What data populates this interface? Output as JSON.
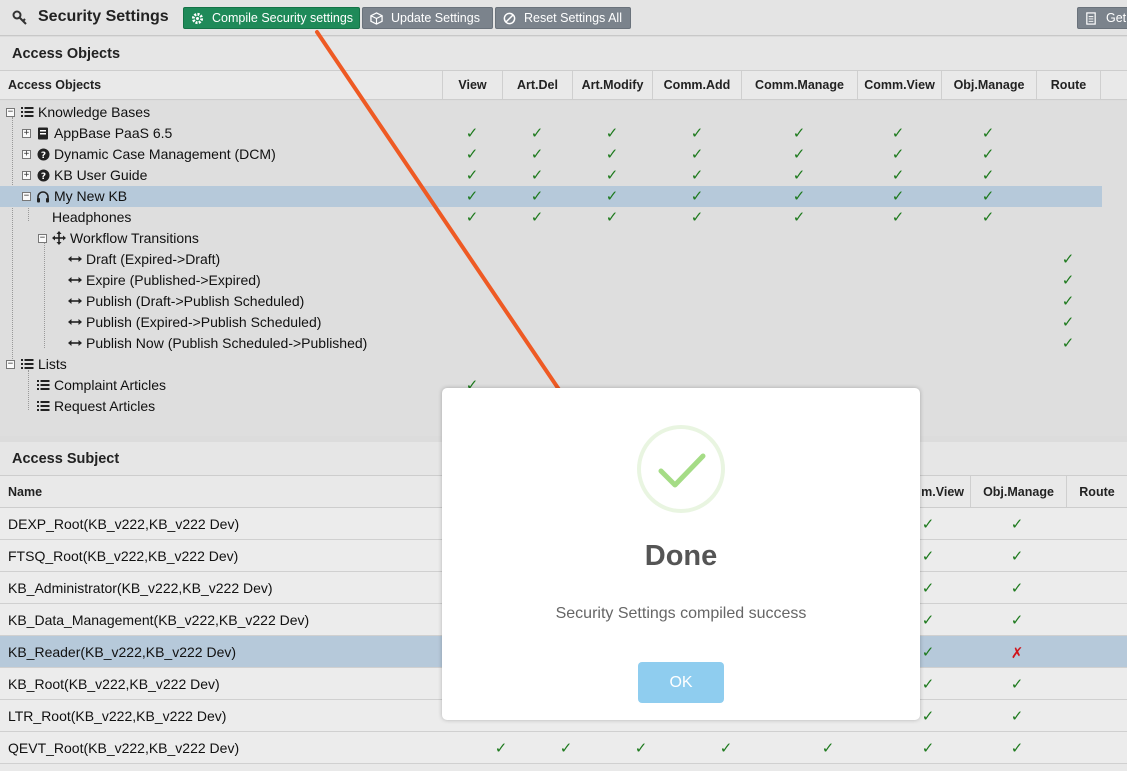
{
  "toolbar": {
    "title": "Security Settings",
    "title_icon": "key-icon",
    "compile_label": "Compile Security settings",
    "update_label": "Update Settings",
    "reset_label": "Reset Settings All",
    "get_label": "Get"
  },
  "objects_section": {
    "title": "Access Objects",
    "columns": [
      "Access Objects",
      "View",
      "Art.Del",
      "Art.Modify",
      "Comm.Add",
      "Comm.Manage",
      "Comm.View",
      "Obj.Manage",
      "Route"
    ],
    "rows": [
      {
        "label": "Knowledge Bases",
        "icon": "list-icon",
        "expander": "minus",
        "checks": []
      },
      {
        "label": "AppBase PaaS 6.5",
        "icon": "book-icon",
        "expander": "plus",
        "checks": [
          "View",
          "Art.Del",
          "Art.Modify",
          "Comm.Add",
          "Comm.Manage",
          "Comm.View",
          "Obj.Manage"
        ]
      },
      {
        "label": "Dynamic Case Management (DCM)",
        "icon": "question-icon",
        "expander": "plus",
        "checks": [
          "View",
          "Art.Del",
          "Art.Modify",
          "Comm.Add",
          "Comm.Manage",
          "Comm.View",
          "Obj.Manage"
        ]
      },
      {
        "label": "KB User Guide",
        "icon": "question-icon",
        "expander": "plus",
        "checks": [
          "View",
          "Art.Del",
          "Art.Modify",
          "Comm.Add",
          "Comm.Manage",
          "Comm.View",
          "Obj.Manage"
        ]
      },
      {
        "label": "My New KB",
        "icon": "headphones-icon",
        "expander": "minus",
        "selected": true,
        "checks": [
          "View",
          "Art.Del",
          "Art.Modify",
          "Comm.Add",
          "Comm.Manage",
          "Comm.View",
          "Obj.Manage"
        ]
      },
      {
        "label": "Headphones",
        "icon": "",
        "expander": "",
        "checks": [
          "View",
          "Art.Del",
          "Art.Modify",
          "Comm.Add",
          "Comm.Manage",
          "Comm.View",
          "Obj.Manage"
        ]
      },
      {
        "label": "Workflow Transitions",
        "icon": "arrows-move-icon",
        "expander": "minus",
        "checks": []
      },
      {
        "label": "Draft (Expired->Draft)",
        "icon": "arrow-horizontal-icon",
        "expander": "",
        "checks": [
          "Route"
        ]
      },
      {
        "label": "Expire (Published->Expired)",
        "icon": "arrow-horizontal-icon",
        "expander": "",
        "checks": [
          "Route"
        ]
      },
      {
        "label": "Publish (Draft->Publish Scheduled)",
        "icon": "arrow-horizontal-icon",
        "expander": "",
        "checks": [
          "Route"
        ]
      },
      {
        "label": "Publish (Expired->Publish Scheduled)",
        "icon": "arrow-horizontal-icon",
        "expander": "",
        "checks": [
          "Route"
        ]
      },
      {
        "label": "Publish Now (Publish Scheduled->Published)",
        "icon": "arrow-horizontal-icon",
        "expander": "",
        "checks": [
          "Route"
        ]
      },
      {
        "label": "Lists",
        "icon": "list-icon",
        "expander": "minus",
        "checks": []
      },
      {
        "label": "Complaint Articles",
        "icon": "list-icon",
        "expander": "",
        "checks": [
          "View"
        ]
      },
      {
        "label": "Request Articles",
        "icon": "list-icon",
        "expander": "",
        "checks": []
      }
    ]
  },
  "subject_section": {
    "title": "Access Subject",
    "columns": [
      "Name",
      "m.View",
      "Obj.Manage",
      "Route"
    ],
    "rows": [
      {
        "name": "DEXP_Root(KB_v222,KB_v222 Dev)",
        "comm_view": "check",
        "obj_manage": "check"
      },
      {
        "name": "FTSQ_Root(KB_v222,KB_v222 Dev)",
        "comm_view": "check",
        "obj_manage": "check"
      },
      {
        "name": "KB_Administrator(KB_v222,KB_v222 Dev)",
        "comm_view": "check",
        "obj_manage": "check"
      },
      {
        "name": "KB_Data_Management(KB_v222,KB_v222 Dev)",
        "comm_view": "check",
        "obj_manage": "check"
      },
      {
        "name": "KB_Reader(KB_v222,KB_v222 Dev)",
        "comm_view": "check",
        "obj_manage": "cross",
        "selected": true
      },
      {
        "name": "KB_Root(KB_v222,KB_v222 Dev)",
        "comm_view": "check",
        "obj_manage": "check"
      },
      {
        "name": "LTR_Root(KB_v222,KB_v222 Dev)",
        "comm_view": "check",
        "obj_manage": "check"
      },
      {
        "name": "QEVT_Root(KB_v222,KB_v222 Dev)",
        "comm_view": "check",
        "obj_manage": "check",
        "full_checks": true
      }
    ]
  },
  "dialog": {
    "title": "Done",
    "message": "Security Settings compiled success",
    "ok_label": "OK",
    "icon": "success-check-icon"
  },
  "colors": {
    "compile_button": "#1f8a59",
    "secondary_button": "#7b838c",
    "check_green": "#1e7a1e",
    "cross_red": "#d0141b",
    "selected_row": "#b6c9da",
    "annotation_arrow": "#ee5a24",
    "ok_button": "#8fcdef",
    "success_check": "#a5dc86"
  }
}
